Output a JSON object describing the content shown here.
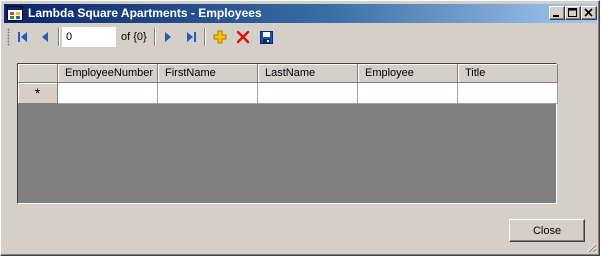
{
  "window": {
    "title": "Lambda Square Apartments - Employees",
    "title_bar_color": "#0a246a"
  },
  "caption_buttons": [
    "minimize-icon",
    "maximize-icon",
    "close-icon"
  ],
  "navigator": {
    "position_value": "0",
    "count_label": "of {0}",
    "buttons": [
      "move-first-icon",
      "move-previous-icon",
      "move-next-icon",
      "move-last-icon",
      "add-new-icon",
      "delete-icon",
      "save-icon"
    ]
  },
  "grid": {
    "columns": [
      "EmployeeNumber",
      "FirstName",
      "LastName",
      "Employee",
      "Title"
    ],
    "new_row_marker": "*",
    "background_color": "#808080"
  },
  "footer": {
    "close_label": "Close"
  }
}
